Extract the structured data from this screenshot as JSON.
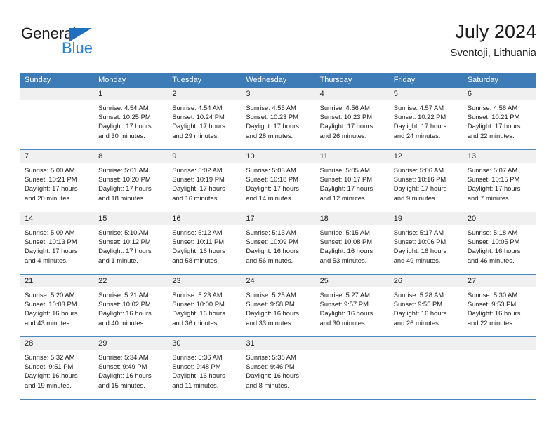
{
  "brand": {
    "name_top": "General",
    "name_bottom": "Blue",
    "triangle_color": "#1f6fc0",
    "blue_text_color": "#1f7fd4"
  },
  "header": {
    "title": "July 2024",
    "subtitle": "Sventoji, Lithuania"
  },
  "colors": {
    "header_row_bg": "#3e7cb8",
    "daynum_band_bg": "#f0f0f0",
    "row_divider": "#4a86c0",
    "text": "#1a1a1a"
  },
  "weekdays": [
    "Sunday",
    "Monday",
    "Tuesday",
    "Wednesday",
    "Thursday",
    "Friday",
    "Saturday"
  ],
  "weeks": [
    [
      {
        "day": "",
        "sunrise": "",
        "sunset": "",
        "daylight_1": "",
        "daylight_2": ""
      },
      {
        "day": "1",
        "sunrise": "Sunrise: 4:54 AM",
        "sunset": "Sunset: 10:25 PM",
        "daylight_1": "Daylight: 17 hours",
        "daylight_2": "and 30 minutes."
      },
      {
        "day": "2",
        "sunrise": "Sunrise: 4:54 AM",
        "sunset": "Sunset: 10:24 PM",
        "daylight_1": "Daylight: 17 hours",
        "daylight_2": "and 29 minutes."
      },
      {
        "day": "3",
        "sunrise": "Sunrise: 4:55 AM",
        "sunset": "Sunset: 10:23 PM",
        "daylight_1": "Daylight: 17 hours",
        "daylight_2": "and 28 minutes."
      },
      {
        "day": "4",
        "sunrise": "Sunrise: 4:56 AM",
        "sunset": "Sunset: 10:23 PM",
        "daylight_1": "Daylight: 17 hours",
        "daylight_2": "and 26 minutes."
      },
      {
        "day": "5",
        "sunrise": "Sunrise: 4:57 AM",
        "sunset": "Sunset: 10:22 PM",
        "daylight_1": "Daylight: 17 hours",
        "daylight_2": "and 24 minutes."
      },
      {
        "day": "6",
        "sunrise": "Sunrise: 4:58 AM",
        "sunset": "Sunset: 10:21 PM",
        "daylight_1": "Daylight: 17 hours",
        "daylight_2": "and 22 minutes."
      }
    ],
    [
      {
        "day": "7",
        "sunrise": "Sunrise: 5:00 AM",
        "sunset": "Sunset: 10:21 PM",
        "daylight_1": "Daylight: 17 hours",
        "daylight_2": "and 20 minutes."
      },
      {
        "day": "8",
        "sunrise": "Sunrise: 5:01 AM",
        "sunset": "Sunset: 10:20 PM",
        "daylight_1": "Daylight: 17 hours",
        "daylight_2": "and 18 minutes."
      },
      {
        "day": "9",
        "sunrise": "Sunrise: 5:02 AM",
        "sunset": "Sunset: 10:19 PM",
        "daylight_1": "Daylight: 17 hours",
        "daylight_2": "and 16 minutes."
      },
      {
        "day": "10",
        "sunrise": "Sunrise: 5:03 AM",
        "sunset": "Sunset: 10:18 PM",
        "daylight_1": "Daylight: 17 hours",
        "daylight_2": "and 14 minutes."
      },
      {
        "day": "11",
        "sunrise": "Sunrise: 5:05 AM",
        "sunset": "Sunset: 10:17 PM",
        "daylight_1": "Daylight: 17 hours",
        "daylight_2": "and 12 minutes."
      },
      {
        "day": "12",
        "sunrise": "Sunrise: 5:06 AM",
        "sunset": "Sunset: 10:16 PM",
        "daylight_1": "Daylight: 17 hours",
        "daylight_2": "and 9 minutes."
      },
      {
        "day": "13",
        "sunrise": "Sunrise: 5:07 AM",
        "sunset": "Sunset: 10:15 PM",
        "daylight_1": "Daylight: 17 hours",
        "daylight_2": "and 7 minutes."
      }
    ],
    [
      {
        "day": "14",
        "sunrise": "Sunrise: 5:09 AM",
        "sunset": "Sunset: 10:13 PM",
        "daylight_1": "Daylight: 17 hours",
        "daylight_2": "and 4 minutes."
      },
      {
        "day": "15",
        "sunrise": "Sunrise: 5:10 AM",
        "sunset": "Sunset: 10:12 PM",
        "daylight_1": "Daylight: 17 hours",
        "daylight_2": "and 1 minute."
      },
      {
        "day": "16",
        "sunrise": "Sunrise: 5:12 AM",
        "sunset": "Sunset: 10:11 PM",
        "daylight_1": "Daylight: 16 hours",
        "daylight_2": "and 58 minutes."
      },
      {
        "day": "17",
        "sunrise": "Sunrise: 5:13 AM",
        "sunset": "Sunset: 10:09 PM",
        "daylight_1": "Daylight: 16 hours",
        "daylight_2": "and 56 minutes."
      },
      {
        "day": "18",
        "sunrise": "Sunrise: 5:15 AM",
        "sunset": "Sunset: 10:08 PM",
        "daylight_1": "Daylight: 16 hours",
        "daylight_2": "and 53 minutes."
      },
      {
        "day": "19",
        "sunrise": "Sunrise: 5:17 AM",
        "sunset": "Sunset: 10:06 PM",
        "daylight_1": "Daylight: 16 hours",
        "daylight_2": "and 49 minutes."
      },
      {
        "day": "20",
        "sunrise": "Sunrise: 5:18 AM",
        "sunset": "Sunset: 10:05 PM",
        "daylight_1": "Daylight: 16 hours",
        "daylight_2": "and 46 minutes."
      }
    ],
    [
      {
        "day": "21",
        "sunrise": "Sunrise: 5:20 AM",
        "sunset": "Sunset: 10:03 PM",
        "daylight_1": "Daylight: 16 hours",
        "daylight_2": "and 43 minutes."
      },
      {
        "day": "22",
        "sunrise": "Sunrise: 5:21 AM",
        "sunset": "Sunset: 10:02 PM",
        "daylight_1": "Daylight: 16 hours",
        "daylight_2": "and 40 minutes."
      },
      {
        "day": "23",
        "sunrise": "Sunrise: 5:23 AM",
        "sunset": "Sunset: 10:00 PM",
        "daylight_1": "Daylight: 16 hours",
        "daylight_2": "and 36 minutes."
      },
      {
        "day": "24",
        "sunrise": "Sunrise: 5:25 AM",
        "sunset": "Sunset: 9:58 PM",
        "daylight_1": "Daylight: 16 hours",
        "daylight_2": "and 33 minutes."
      },
      {
        "day": "25",
        "sunrise": "Sunrise: 5:27 AM",
        "sunset": "Sunset: 9:57 PM",
        "daylight_1": "Daylight: 16 hours",
        "daylight_2": "and 30 minutes."
      },
      {
        "day": "26",
        "sunrise": "Sunrise: 5:28 AM",
        "sunset": "Sunset: 9:55 PM",
        "daylight_1": "Daylight: 16 hours",
        "daylight_2": "and 26 minutes."
      },
      {
        "day": "27",
        "sunrise": "Sunrise: 5:30 AM",
        "sunset": "Sunset: 9:53 PM",
        "daylight_1": "Daylight: 16 hours",
        "daylight_2": "and 22 minutes."
      }
    ],
    [
      {
        "day": "28",
        "sunrise": "Sunrise: 5:32 AM",
        "sunset": "Sunset: 9:51 PM",
        "daylight_1": "Daylight: 16 hours",
        "daylight_2": "and 19 minutes."
      },
      {
        "day": "29",
        "sunrise": "Sunrise: 5:34 AM",
        "sunset": "Sunset: 9:49 PM",
        "daylight_1": "Daylight: 16 hours",
        "daylight_2": "and 15 minutes."
      },
      {
        "day": "30",
        "sunrise": "Sunrise: 5:36 AM",
        "sunset": "Sunset: 9:48 PM",
        "daylight_1": "Daylight: 16 hours",
        "daylight_2": "and 11 minutes."
      },
      {
        "day": "31",
        "sunrise": "Sunrise: 5:38 AM",
        "sunset": "Sunset: 9:46 PM",
        "daylight_1": "Daylight: 16 hours",
        "daylight_2": "and 8 minutes."
      },
      {
        "day": "",
        "sunrise": "",
        "sunset": "",
        "daylight_1": "",
        "daylight_2": ""
      },
      {
        "day": "",
        "sunrise": "",
        "sunset": "",
        "daylight_1": "",
        "daylight_2": ""
      },
      {
        "day": "",
        "sunrise": "",
        "sunset": "",
        "daylight_1": "",
        "daylight_2": ""
      }
    ]
  ]
}
